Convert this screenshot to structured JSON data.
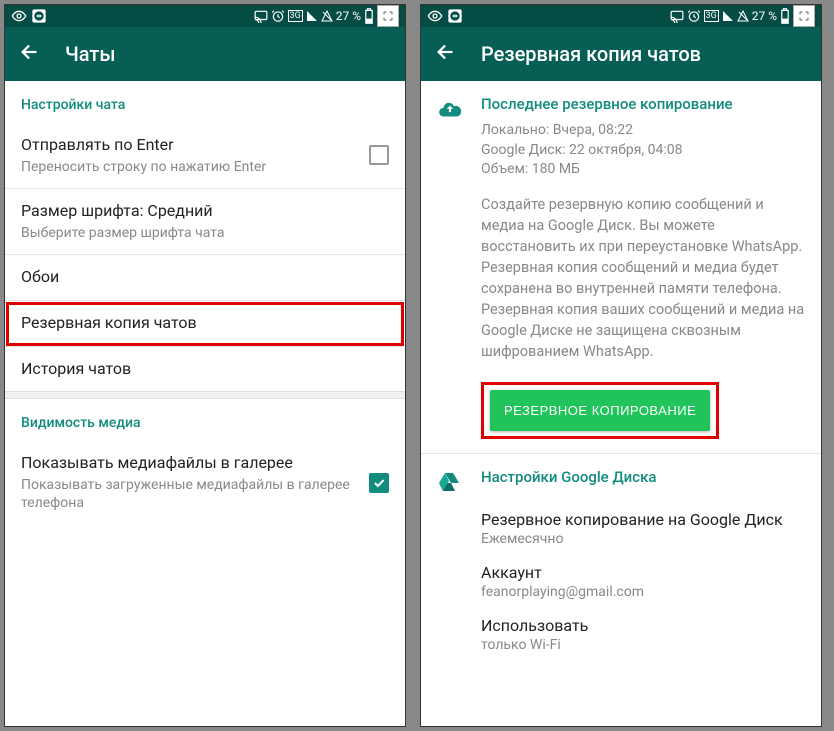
{
  "statusbar": {
    "battery": "27 %"
  },
  "screen1": {
    "title": "Чаты",
    "section1": "Настройки чата",
    "enter": {
      "title": "Отправлять по Enter",
      "sub": "Переносить строку по нажатию Enter"
    },
    "font": {
      "title": "Размер шрифта: Средний",
      "sub": "Выберите размер шрифта чата"
    },
    "wallpaper": {
      "title": "Обои"
    },
    "backup": {
      "title": "Резервная копия чатов"
    },
    "history": {
      "title": "История чатов"
    },
    "section2": "Видимость медиа",
    "media": {
      "title": "Показывать медиафайлы в галерее",
      "sub": "Показывать загруженные медиафайлы в галерее телефона"
    }
  },
  "screen2": {
    "title": "Резервная копия чатов",
    "last": {
      "header": "Последнее резервное копирование",
      "local": "Локально: Вчера, 08:22",
      "gdrive": "Google Диск: 22 октября, 04:08",
      "size": "Объем: 180 МБ",
      "desc": "Создайте резервную копию сообщений и медиа на Google Диск. Вы можете восстановить их при переустановке WhatsApp. Резервная копия сообщений и медиа будет сохранена во внутренней памяти телефона. Резервная копия ваших сообщений и медиа на Google Диске не защищена сквозным шифрованием WhatsApp.",
      "button": "РЕЗЕРВНОЕ КОПИРОВАНИЕ"
    },
    "gd": {
      "header": "Настройки Google Диска",
      "freq_title": "Резервное копирование на Google Диск",
      "freq_value": "Ежемесячно",
      "account_title": "Аккаунт",
      "account_value": "feanorplaying@gmail.com",
      "use_title": "Использовать",
      "use_value": "только Wi-Fi"
    }
  }
}
